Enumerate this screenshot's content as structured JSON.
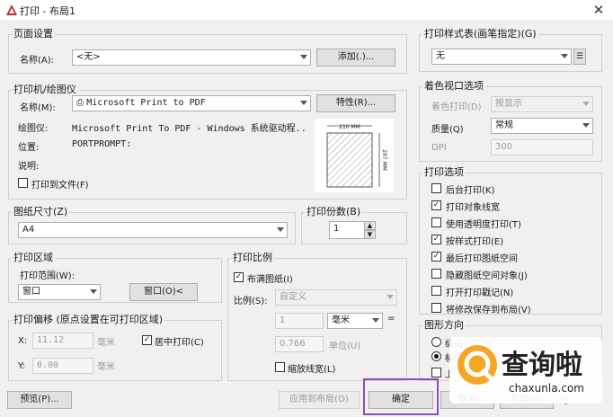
{
  "window": {
    "title": "打印 - 布局1"
  },
  "page_setup": {
    "group_label": "页面设置",
    "name_label": "名称(A):",
    "name_value": "<无>",
    "add_button": "添加(.)..."
  },
  "printer": {
    "group_label": "打印机/绘图仪",
    "name_label": "名称(M):",
    "name_value": "Microsoft Print to PDF",
    "properties_button": "特性(R)...",
    "plotter_label": "绘图仪:",
    "plotter_value": "Microsoft Print To PDF - Windows 系统驱动程...",
    "location_label": "位置:",
    "location_value": "PORTPROMPT:",
    "description_label": "说明:",
    "print_to_file_label": "打印到文件(F)",
    "preview_width": "210 MM",
    "preview_height": "297 MM"
  },
  "paper_size": {
    "group_label": "图纸尺寸(Z)",
    "value": "A4"
  },
  "copies": {
    "group_label": "打印份数(B)",
    "value": "1"
  },
  "print_area": {
    "group_label": "打印区域",
    "range_label": "打印范围(W):",
    "range_value": "窗口",
    "window_button": "窗口(O)<"
  },
  "print_offset": {
    "group_label": "打印偏移 (原点设置在可打印区域)",
    "x_label": "X:",
    "x_value": "11.12",
    "x_unit": "毫米",
    "y_label": "Y:",
    "y_value": "0.00",
    "y_unit": "毫米",
    "center_label": "居中打印(C)"
  },
  "print_scale": {
    "group_label": "打印比例",
    "fit_label": "布满图纸(I)",
    "scale_label": "比例(S):",
    "scale_value": "自定义",
    "num_value": "1",
    "unit_value": "毫米",
    "equals": "=",
    "den_value": "0.766",
    "den_unit": "单位(U)",
    "lineweight_label": "缩放线宽(L)"
  },
  "plot_style": {
    "group_label": "打印样式表(画笔指定)(G)",
    "value": "无"
  },
  "shaded": {
    "group_label": "着色视口选项",
    "shade_label": "着色打印(D)",
    "shade_value": "按显示",
    "quality_label": "质量(Q)",
    "quality_value": "常规",
    "dpi_label": "DPI",
    "dpi_value": "300"
  },
  "options": {
    "group_label": "打印选项",
    "items": [
      {
        "label": "后台打印(K)",
        "checked": false
      },
      {
        "label": "打印对象线宽",
        "checked": true
      },
      {
        "label": "使用透明度打印(T)",
        "checked": false
      },
      {
        "label": "按样式打印(E)",
        "checked": true
      },
      {
        "label": "最后打印图纸空间",
        "checked": true
      },
      {
        "label": "隐藏图纸空间对象(J)",
        "checked": false
      },
      {
        "label": "打开打印戳记(N)",
        "checked": false
      },
      {
        "label": "将修改保存到布局(V)",
        "checked": false
      }
    ]
  },
  "orientation": {
    "group_label": "图形方向",
    "opt1": "纵向",
    "opt2": "横向",
    "opt3": "上"
  },
  "footer": {
    "preview_button": "预览(P)...",
    "apply_button": "应用到布局(O)",
    "ok_button": "确定",
    "cancel_button": "取消",
    "help_button": "帮助(H)"
  },
  "watermark": {
    "text": "查询啦",
    "domain": "chaxunla.com"
  }
}
